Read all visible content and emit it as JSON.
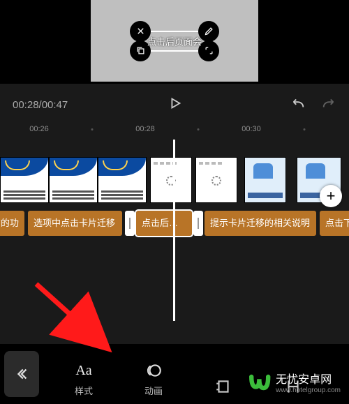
{
  "preview": {
    "caption_text": "点击后页面会"
  },
  "playbar": {
    "time": "00:28/00:47"
  },
  "ruler": {
    "labels": [
      "00:26",
      "00:28",
      "00:30"
    ]
  },
  "timeline": {
    "add_label": "+",
    "text_clips": [
      {
        "label": "方的功"
      },
      {
        "label": "选项中点击卡片迁移"
      },
      {
        "label": "点击后页面",
        "selected": true
      },
      {
        "label": "提示卡片迁移的相关说明"
      },
      {
        "label": "点击下"
      }
    ]
  },
  "toolbar": {
    "style_label": "样式",
    "style_icon_text": "Aa",
    "anim_label": "动画"
  },
  "watermark": {
    "name": "无忧安卓网",
    "url": "www.hotelgroup.com"
  }
}
